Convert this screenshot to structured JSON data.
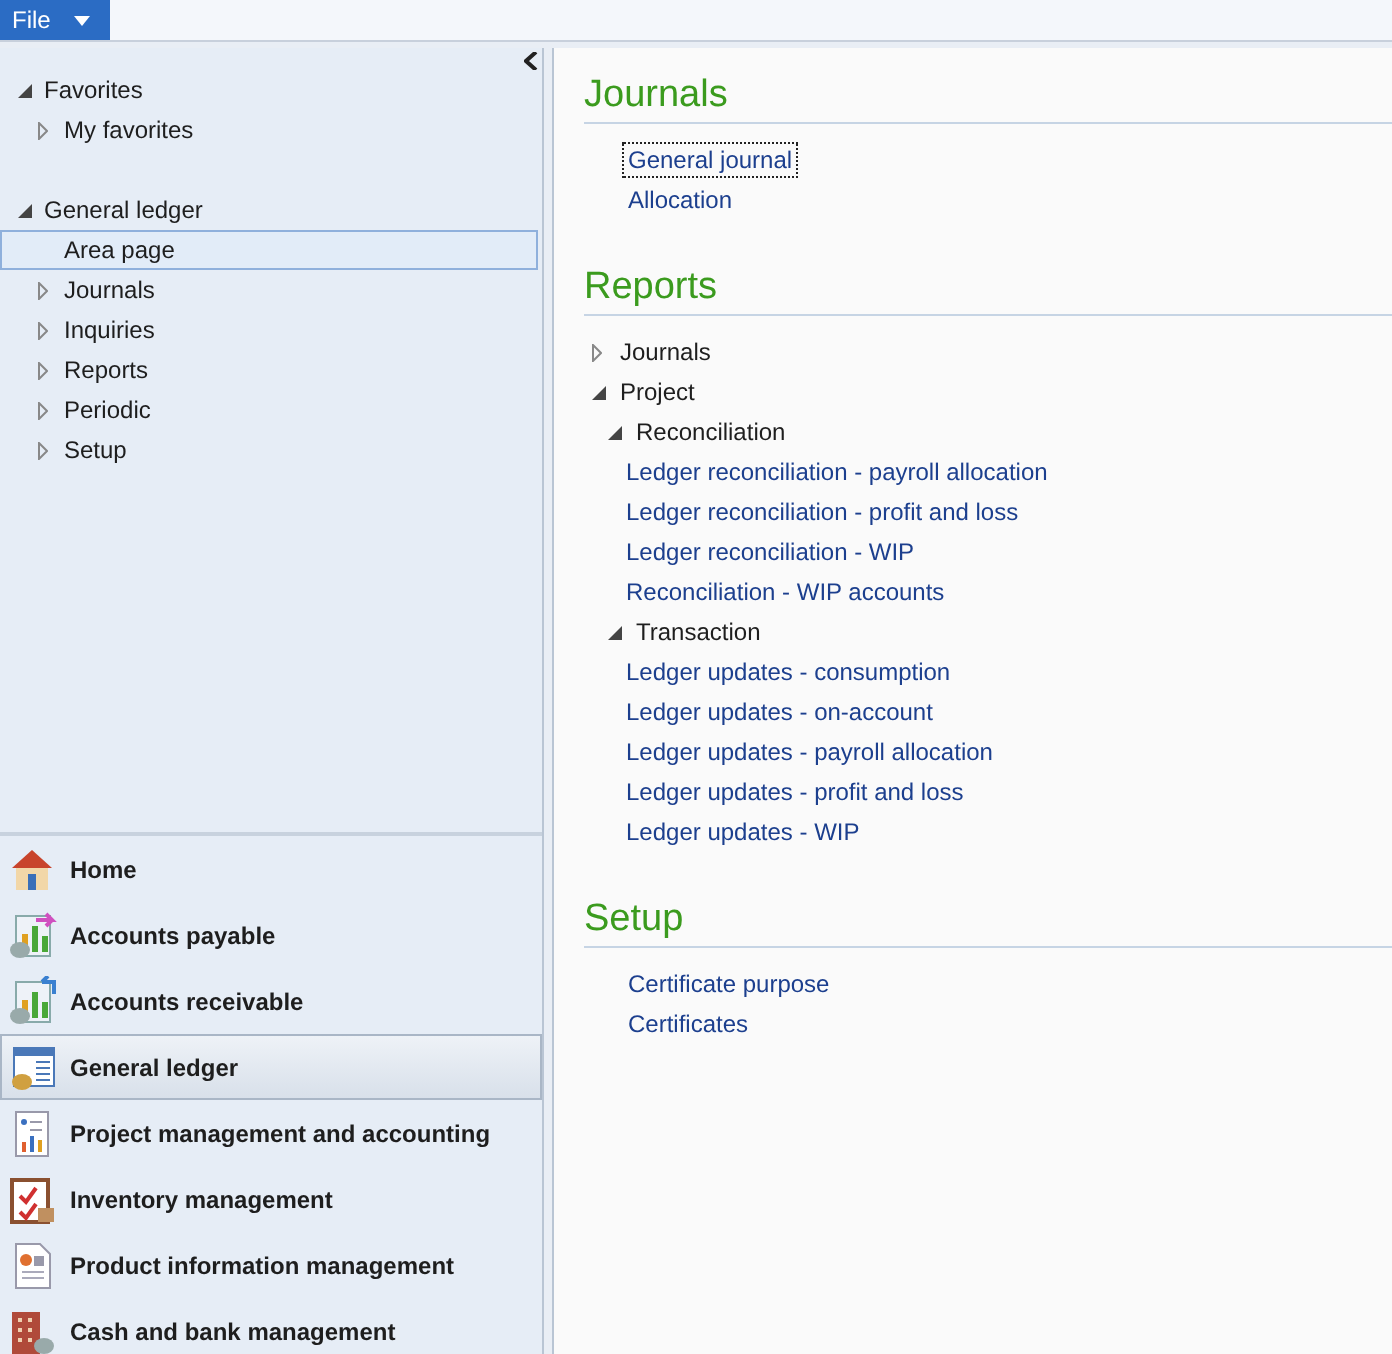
{
  "file_menu": {
    "label": "File"
  },
  "nav_tree": [
    {
      "label": "Favorites",
      "kind": "group",
      "expanded": true,
      "selected": false,
      "children": [
        {
          "label": "My favorites",
          "kind": "group",
          "expanded": false,
          "selected": false
        }
      ]
    },
    {
      "label": "General ledger",
      "kind": "group",
      "expanded": true,
      "selected": false,
      "children": [
        {
          "label": "Area page",
          "kind": "page",
          "selected": true
        },
        {
          "label": "Journals",
          "kind": "group",
          "expanded": false,
          "selected": false
        },
        {
          "label": "Inquiries",
          "kind": "group",
          "expanded": false,
          "selected": false
        },
        {
          "label": "Reports",
          "kind": "group",
          "expanded": false,
          "selected": false
        },
        {
          "label": "Periodic",
          "kind": "group",
          "expanded": false,
          "selected": false
        },
        {
          "label": "Setup",
          "kind": "group",
          "expanded": false,
          "selected": false
        }
      ]
    }
  ],
  "modules": [
    {
      "label": "Home",
      "selected": false
    },
    {
      "label": "Accounts payable",
      "selected": false
    },
    {
      "label": "Accounts receivable",
      "selected": false
    },
    {
      "label": "General ledger",
      "selected": true
    },
    {
      "label": "Project management and accounting",
      "selected": false
    },
    {
      "label": "Inventory management",
      "selected": false
    },
    {
      "label": "Product information management",
      "selected": false
    },
    {
      "label": "Cash and bank management",
      "selected": false
    }
  ],
  "sections": [
    {
      "title": "Journals",
      "kind": "links",
      "links": [
        {
          "label": "General journal",
          "focused": true
        },
        {
          "label": "Allocation",
          "focused": false
        }
      ]
    },
    {
      "title": "Reports",
      "kind": "tree",
      "items": [
        {
          "label": "Journals",
          "kind": "group",
          "expanded": false
        },
        {
          "label": "Project",
          "kind": "group",
          "expanded": true,
          "children": [
            {
              "label": "Reconciliation",
              "kind": "group",
              "expanded": true,
              "children": [
                {
                  "label": "Ledger reconciliation - payroll allocation",
                  "kind": "link"
                },
                {
                  "label": "Ledger reconciliation - profit and loss",
                  "kind": "link"
                },
                {
                  "label": "Ledger reconciliation - WIP",
                  "kind": "link"
                },
                {
                  "label": "Reconciliation - WIP accounts",
                  "kind": "link"
                }
              ]
            },
            {
              "label": "Transaction",
              "kind": "group",
              "expanded": true,
              "children": [
                {
                  "label": "Ledger updates - consumption",
                  "kind": "link"
                },
                {
                  "label": "Ledger updates - on-account",
                  "kind": "link"
                },
                {
                  "label": "Ledger updates - payroll allocation",
                  "kind": "link"
                },
                {
                  "label": "Ledger updates - profit and loss",
                  "kind": "link"
                },
                {
                  "label": "Ledger updates - WIP",
                  "kind": "link"
                }
              ]
            }
          ]
        }
      ]
    },
    {
      "title": "Setup",
      "kind": "links",
      "links": [
        {
          "label": "Certificate purpose",
          "focused": false
        },
        {
          "label": "Certificates",
          "focused": false
        }
      ]
    }
  ]
}
